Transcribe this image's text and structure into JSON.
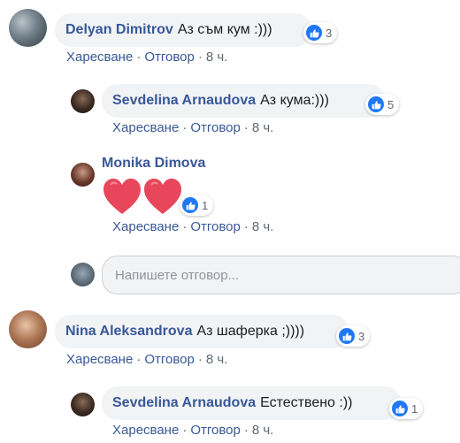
{
  "comments": [
    {
      "author": "Delyan Dimitrov",
      "text": "Аз съм кум :)))",
      "reactions": "3",
      "actions": {
        "like": "Харесване",
        "reply": "Отговор",
        "time": "8 ч."
      }
    },
    {
      "author": "Sevdelina Arnaudova",
      "text": "Аз кума:)))",
      "reactions": "5",
      "actions": {
        "like": "Харесване",
        "reply": "Отговор",
        "time": "8 ч."
      }
    },
    {
      "author": "Monika Dimova",
      "text": "",
      "reactions": "1",
      "actions": {
        "like": "Харесване",
        "reply": "Отговор",
        "time": "8 ч."
      }
    },
    {
      "author": "Nina Aleksandrova",
      "text": "Аз шаферка ;))))",
      "reactions": "3",
      "actions": {
        "like": "Харесване",
        "reply": "Отговор",
        "time": "8 ч."
      }
    },
    {
      "author": "Sevdelina Arnaudova",
      "text": "Естествено :))",
      "reactions": "1",
      "actions": {
        "like": "Харесване",
        "reply": "Отговор",
        "time": "8 ч."
      }
    }
  ],
  "reply_box": {
    "placeholder": "Напишете отговор..."
  },
  "sep": "·",
  "colors": {
    "name": "#385898",
    "like": "#2078f4",
    "heart": "#e8475b",
    "bubble": "#f2f3f5"
  }
}
